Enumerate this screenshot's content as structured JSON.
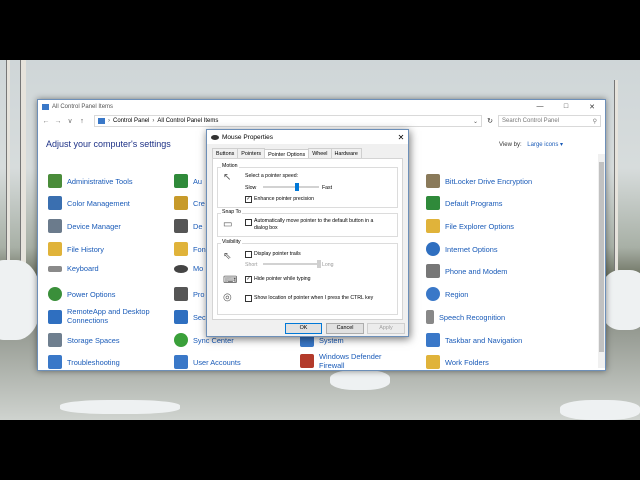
{
  "window": {
    "title": "All Control Panel Items",
    "controls": [
      "—",
      "□",
      "✕"
    ]
  },
  "address": {
    "back": "←",
    "forward": "→",
    "recent": "∨",
    "up": "↑",
    "crumbs": [
      "Control Panel",
      "All Control Panel Items"
    ],
    "refresh": "↻",
    "search_placeholder": "Search Control Panel"
  },
  "content": {
    "heading": "Adjust your computer's settings",
    "view_by_label": "View by:",
    "view_by_value": "Large icons ▾"
  },
  "items": [
    {
      "label": "Administrative Tools",
      "icon": "admin-tools-icon",
      "color": "#4a8c3a"
    },
    {
      "label": "Color Management",
      "icon": "color-management-icon",
      "color": "#3a6fb0"
    },
    {
      "label": "Device Manager",
      "icon": "device-manager-icon",
      "color": "#6b7b8c"
    },
    {
      "label": "File History",
      "icon": "file-history-icon",
      "color": "#e0b33a"
    },
    {
      "label": "Keyboard",
      "icon": "keyboard-icon",
      "color": "#8a8a8a"
    },
    {
      "label": "Power Options",
      "icon": "power-options-icon",
      "color": "#3a8f3a"
    },
    {
      "label": "RemoteApp and Desktop Connections",
      "label2": "Connections",
      "label1": "RemoteApp and Desktop",
      "icon": "remoteapp-icon",
      "color": "#2f6fc0"
    },
    {
      "label": "Storage Spaces",
      "icon": "storage-spaces-icon",
      "color": "#6f7f8f"
    },
    {
      "label": "Troubleshooting",
      "icon": "troubleshooting-icon",
      "color": "#3a78c8"
    }
  ],
  "items_col2": [
    {
      "label": "Au",
      "icon": "autoplay-icon",
      "color": "#2f8a3a"
    },
    {
      "label": "Cre",
      "icon": "credential-manager-icon",
      "color": "#c79a2a"
    },
    {
      "label": "De",
      "icon": "devices-icon",
      "color": "#555"
    },
    {
      "label": "Fon",
      "icon": "fonts-icon",
      "color": "#e0b33a"
    },
    {
      "label": "Mo",
      "icon": "mouse-icon",
      "color": "#444"
    },
    {
      "label": "Pro",
      "icon": "programs-icon",
      "color": "#555"
    },
    {
      "label": "Sec",
      "icon": "security-icon",
      "color": "#2f6fc0"
    },
    {
      "label": "Sync Center",
      "icon": "sync-center-icon",
      "color": "#3aa03a"
    },
    {
      "label": "User Accounts",
      "icon": "user-accounts-icon",
      "color": "#3a78c8"
    }
  ],
  "items_col3": [
    {
      "label": "System",
      "icon": "system-icon",
      "color": "#3a78c8"
    },
    {
      "label": "Windows Defender Firewall",
      "label1": "Windows Defender",
      "label2": "Firewall",
      "icon": "firewall-icon",
      "color": "#b33a2a"
    }
  ],
  "items_col4": [
    {
      "label": "BitLocker Drive Encryption",
      "icon": "bitlocker-icon",
      "color": "#8a7a5a"
    },
    {
      "label": "Default Programs",
      "icon": "default-programs-icon",
      "color": "#2f8a3a"
    },
    {
      "label": "File Explorer Options",
      "icon": "file-explorer-options-icon",
      "color": "#e0b33a"
    },
    {
      "label": "Internet Options",
      "icon": "internet-options-icon",
      "color": "#2f6fc0"
    },
    {
      "label": "Phone and Modem",
      "icon": "phone-modem-icon",
      "color": "#777"
    },
    {
      "label": "Region",
      "icon": "region-icon",
      "color": "#3a78c8"
    },
    {
      "label": "Speech Recognition",
      "icon": "speech-recognition-icon",
      "color": "#888"
    },
    {
      "label": "Taskbar and Navigation",
      "icon": "taskbar-icon",
      "color": "#3a78c8"
    },
    {
      "label": "Work Folders",
      "icon": "work-folders-icon",
      "color": "#e0b33a"
    }
  ],
  "dialog": {
    "title": "Mouse Properties",
    "close": "✕",
    "tabs": [
      "Buttons",
      "Pointers",
      "Pointer Options",
      "Wheel",
      "Hardware"
    ],
    "active_tab": 2,
    "motion": {
      "group": "Motion",
      "speed_label": "Select a pointer speed:",
      "slow": "Slow",
      "fast": "Fast",
      "speed_fraction": 0.6,
      "precision_label": "Enhance pointer precision",
      "precision_checked": true
    },
    "snap": {
      "group": "Snap To",
      "label_line1": "Automatically move pointer to the default button in a",
      "label_line2": "dialog box",
      "checked": false
    },
    "visibility": {
      "group": "Visibility",
      "trails_label": "Display pointer trails",
      "trails_checked": false,
      "short": "Short",
      "long": "Long",
      "trails_fraction": 1.0,
      "hide_label": "Hide pointer while typing",
      "hide_checked": true,
      "ctrl_label": "Show location of pointer when I press the CTRL key",
      "ctrl_checked": false
    },
    "buttons": {
      "ok": "OK",
      "cancel": "Cancel",
      "apply": "Apply"
    }
  }
}
